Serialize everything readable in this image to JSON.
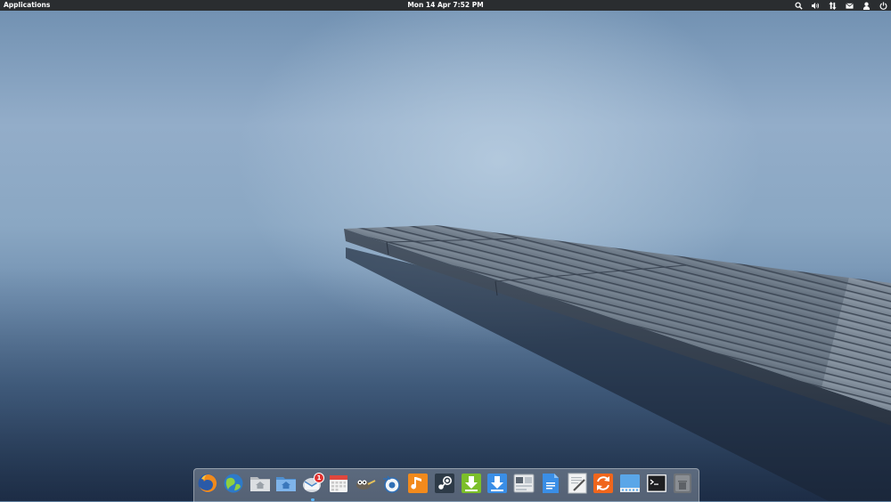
{
  "panel": {
    "applications_label": "Applications",
    "clock": "Mon 14 Apr  7:52 PM",
    "indicators": [
      {
        "name": "search-icon"
      },
      {
        "name": "volume-icon"
      },
      {
        "name": "network-icon"
      },
      {
        "name": "messages-icon"
      },
      {
        "name": "user-icon"
      },
      {
        "name": "power-icon"
      }
    ]
  },
  "dock": {
    "items": [
      {
        "app": "Firefox",
        "icon": "firefox-icon"
      },
      {
        "app": "Midori",
        "icon": "midori-icon"
      },
      {
        "app": "Files Home",
        "icon": "home-folder-icon"
      },
      {
        "app": "Files",
        "icon": "folder-icon"
      },
      {
        "app": "Geary Mail",
        "icon": "mail-icon",
        "badge": "1",
        "running": true
      },
      {
        "app": "Calendar",
        "icon": "calendar-icon"
      },
      {
        "app": "GIMP",
        "icon": "gimp-icon"
      },
      {
        "app": "Blender",
        "icon": "blender-icon"
      },
      {
        "app": "Music",
        "icon": "music-icon"
      },
      {
        "app": "Steam",
        "icon": "steam-icon"
      },
      {
        "app": "Downloader",
        "icon": "download-green-icon"
      },
      {
        "app": "Transmission",
        "icon": "download-blue-icon"
      },
      {
        "app": "Settings",
        "icon": "settings-icon"
      },
      {
        "app": "Documents",
        "icon": "document-icon"
      },
      {
        "app": "Text Editor",
        "icon": "text-editor-icon"
      },
      {
        "app": "Updater",
        "icon": "update-icon"
      },
      {
        "app": "Desktop",
        "icon": "desktop-icon"
      },
      {
        "app": "Terminal",
        "icon": "terminal-icon"
      },
      {
        "app": "Trash",
        "icon": "trash-icon"
      }
    ]
  },
  "colors": {
    "panel_bg": "#2a2d30",
    "badge": "#e0312f",
    "running_indicator": "#5cb8ff"
  }
}
